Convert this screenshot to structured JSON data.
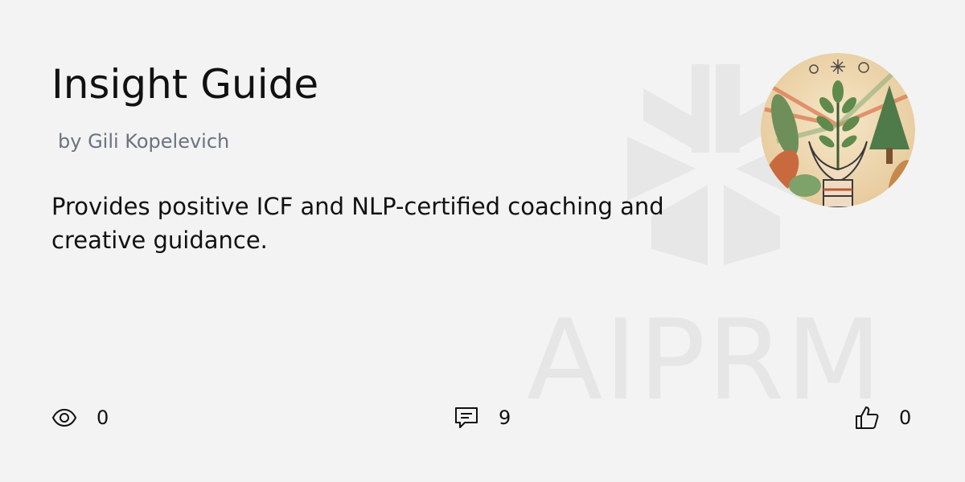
{
  "card": {
    "title": "Insight Guide",
    "author": "by Gili Kopelevich",
    "description": "Provides positive ICF and NLP-certified coaching and creative guidance."
  },
  "stats": {
    "views": {
      "icon": "eye-icon",
      "value": "0"
    },
    "comments": {
      "icon": "comment-icon",
      "value": "9"
    },
    "likes": {
      "icon": "thumbs-up-icon",
      "value": "0"
    }
  },
  "watermark": {
    "text": "AIPRM"
  },
  "colors": {
    "background": "#f3f3f3",
    "text": "#111111",
    "muted": "#6b7280",
    "watermark": "#e6e6e6"
  }
}
